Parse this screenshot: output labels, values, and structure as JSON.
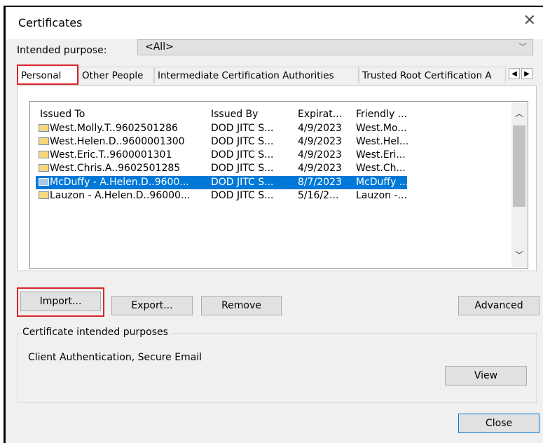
{
  "window": {
    "title": "Certificates"
  },
  "intended_purpose": {
    "label": "Intended purpose:",
    "value": "<All>"
  },
  "tabs": [
    {
      "label": "Personal",
      "active": true
    },
    {
      "label": "Other People",
      "active": false
    },
    {
      "label": "Intermediate Certification Authorities",
      "active": false
    },
    {
      "label": "Trusted Root Certification A",
      "active": false
    }
  ],
  "columns": [
    "Issued To",
    "Issued By",
    "Expirat...",
    "Friendly ..."
  ],
  "certificates": [
    {
      "issued_to": "West.Molly.T..9602501286",
      "issued_by": "DOD JITC S...",
      "expiration": "4/9/2023",
      "friendly": "West.Mo...",
      "selected": false
    },
    {
      "issued_to": "West.Helen.D..9600001300",
      "issued_by": "DOD JITC S...",
      "expiration": "4/9/2023",
      "friendly": "West.Hel...",
      "selected": false
    },
    {
      "issued_to": "West.Eric.T..9600001301",
      "issued_by": "DOD JITC S...",
      "expiration": "4/9/2023",
      "friendly": "West.Eri...",
      "selected": false
    },
    {
      "issued_to": "West.Chris.A..9602501285",
      "issued_by": "DOD JITC S...",
      "expiration": "4/9/2023",
      "friendly": "West.Ch...",
      "selected": false
    },
    {
      "issued_to": "McDuffy - A.Helen.D..9600...",
      "issued_by": "DOD JITC S...",
      "expiration": "8/7/2023",
      "friendly": "McDuffy ...",
      "selected": true
    },
    {
      "issued_to": "Lauzon - A.Helen.D..96000...",
      "issued_by": "DOD JITC S...",
      "expiration": "5/16/2...",
      "friendly": "Lauzon -...",
      "selected": false
    }
  ],
  "buttons": {
    "import": "Import...",
    "export": "Export...",
    "remove": "Remove",
    "advanced": "Advanced",
    "view": "View",
    "close": "Close"
  },
  "purposes_group": {
    "label": "Certificate intended purposes",
    "text": "Client Authentication, Secure Email"
  },
  "icons": {
    "close": "close-icon",
    "dropdown": "chevron-down-icon",
    "scroll_left": "arrow-left-icon",
    "scroll_right": "arrow-right-icon",
    "certificate": "certificate-icon"
  },
  "colors": {
    "selection": "#0078d7",
    "highlight_outline": "#d9242b",
    "dialog_bg": "#f0f0f0"
  }
}
